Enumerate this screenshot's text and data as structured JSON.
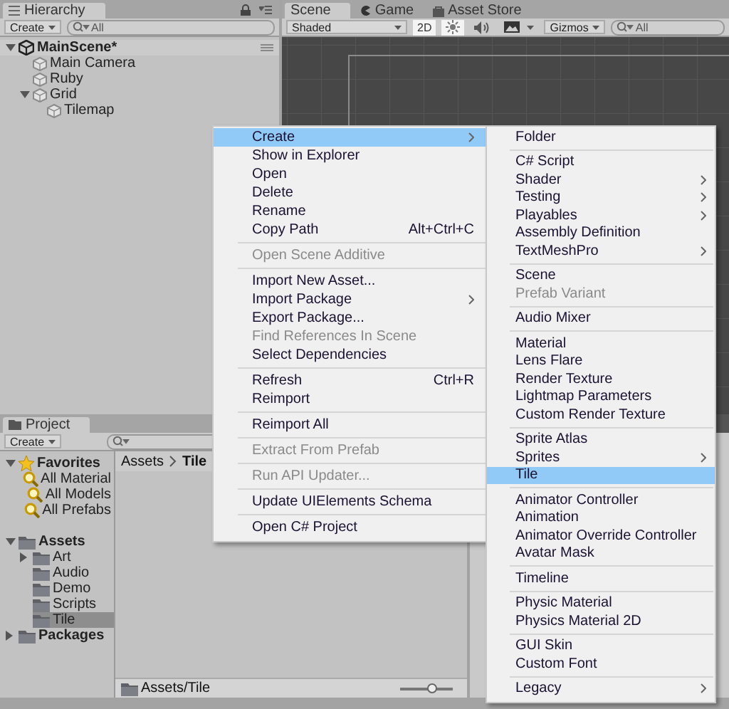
{
  "hierarchy": {
    "tab": "Hierarchy",
    "create_button": "Create",
    "search": {
      "placeholder": "All"
    },
    "scene": {
      "name": "MainScene*",
      "expanded": true,
      "children": [
        {
          "name": "Main Camera",
          "kind": "gameobject"
        },
        {
          "name": "Ruby",
          "kind": "gameobject"
        },
        {
          "name": "Grid",
          "kind": "gameobject",
          "expanded": true,
          "children": [
            {
              "name": "Tilemap",
              "kind": "gameobject"
            }
          ]
        }
      ]
    }
  },
  "scene_view": {
    "tabs": [
      {
        "label": "Scene",
        "kind": "scene",
        "selected": true
      },
      {
        "label": "Game",
        "kind": "game",
        "selected": false
      },
      {
        "label": "Asset Store",
        "kind": "store",
        "selected": false
      }
    ],
    "shading": "Shaded",
    "toggles": [
      {
        "kind": "dimension",
        "label": "2D",
        "on": true
      },
      {
        "kind": "lighting",
        "on": true
      },
      {
        "kind": "audio",
        "on": false
      },
      {
        "kind": "effects",
        "on": false
      }
    ],
    "gizmos": "Gizmos",
    "search": {
      "placeholder": "All"
    }
  },
  "project": {
    "tab": "Project",
    "create_button": "Create",
    "tree": [
      {
        "name": "Favorites",
        "kind": "favorites",
        "expanded": true,
        "selected": false,
        "children": [
          {
            "name": "All Material",
            "kind": "search",
            "selected": false
          },
          {
            "name": "All Models",
            "kind": "search",
            "selected": false
          },
          {
            "name": "All Prefabs",
            "kind": "search",
            "selected": false
          }
        ]
      },
      {
        "name": "Assets",
        "kind": "folder",
        "expanded": true,
        "selected": false,
        "children": [
          {
            "name": "Art",
            "kind": "folder",
            "expanded": false,
            "selected": false
          },
          {
            "name": "Audio",
            "kind": "folder",
            "selected": false
          },
          {
            "name": "Demo",
            "kind": "folder",
            "selected": false
          },
          {
            "name": "Scripts",
            "kind": "folder",
            "selected": false
          },
          {
            "name": "Tile",
            "kind": "folder",
            "selected": true
          }
        ]
      },
      {
        "name": "Packages",
        "kind": "folder",
        "expanded": false,
        "selected": false
      }
    ],
    "breadcrumb": [
      "Assets",
      "Tile"
    ],
    "footer_path": "Assets/Tile",
    "icon_size": {
      "level": 0.6
    }
  },
  "context_menu": {
    "groups": [
      [
        {
          "label": "Create",
          "selected": true,
          "disabled": false,
          "submenu": true
        },
        {
          "label": "Show in Explorer",
          "selected": false,
          "disabled": false,
          "submenu": false
        },
        {
          "label": "Open",
          "selected": false,
          "disabled": false,
          "submenu": false
        },
        {
          "label": "Delete",
          "selected": false,
          "disabled": false,
          "submenu": false
        },
        {
          "label": "Rename",
          "selected": false,
          "disabled": false,
          "submenu": false
        },
        {
          "label": "Copy Path",
          "shortcut": "Alt+Ctrl+C",
          "selected": false,
          "disabled": false,
          "submenu": false
        }
      ],
      [
        {
          "label": "Open Scene Additive",
          "selected": false,
          "disabled": true,
          "submenu": false
        }
      ],
      [
        {
          "label": "Import New Asset...",
          "selected": false,
          "disabled": false,
          "submenu": false
        },
        {
          "label": "Import Package",
          "selected": false,
          "disabled": false,
          "submenu": true
        },
        {
          "label": "Export Package...",
          "selected": false,
          "disabled": false,
          "submenu": false
        },
        {
          "label": "Find References In Scene",
          "selected": false,
          "disabled": true,
          "submenu": false
        },
        {
          "label": "Select Dependencies",
          "selected": false,
          "disabled": false,
          "submenu": false
        }
      ],
      [
        {
          "label": "Refresh",
          "shortcut": "Ctrl+R",
          "selected": false,
          "disabled": false,
          "submenu": false
        },
        {
          "label": "Reimport",
          "selected": false,
          "disabled": false,
          "submenu": false
        }
      ],
      [
        {
          "label": "Reimport All",
          "selected": false,
          "disabled": false,
          "submenu": false
        }
      ],
      [
        {
          "label": "Extract From Prefab",
          "selected": false,
          "disabled": true,
          "submenu": false
        }
      ],
      [
        {
          "label": "Run API Updater...",
          "selected": false,
          "disabled": true,
          "submenu": false
        }
      ],
      [
        {
          "label": "Update UIElements Schema",
          "selected": false,
          "disabled": false,
          "submenu": false
        }
      ],
      [
        {
          "label": "Open C# Project",
          "selected": false,
          "disabled": false,
          "submenu": false
        }
      ]
    ]
  },
  "create_submenu": {
    "groups": [
      [
        {
          "label": "Folder",
          "selected": false,
          "disabled": false,
          "submenu": false
        }
      ],
      [
        {
          "label": "C# Script",
          "selected": false,
          "disabled": false,
          "submenu": false
        },
        {
          "label": "Shader",
          "selected": false,
          "disabled": false,
          "submenu": true
        },
        {
          "label": "Testing",
          "selected": false,
          "disabled": false,
          "submenu": true
        },
        {
          "label": "Playables",
          "selected": false,
          "disabled": false,
          "submenu": true
        },
        {
          "label": "Assembly Definition",
          "selected": false,
          "disabled": false,
          "submenu": false
        },
        {
          "label": "TextMeshPro",
          "selected": false,
          "disabled": false,
          "submenu": true
        }
      ],
      [
        {
          "label": "Scene",
          "selected": false,
          "disabled": false,
          "submenu": false
        },
        {
          "label": "Prefab Variant",
          "selected": false,
          "disabled": true,
          "submenu": false
        }
      ],
      [
        {
          "label": "Audio Mixer",
          "selected": false,
          "disabled": false,
          "submenu": false
        }
      ],
      [
        {
          "label": "Material",
          "selected": false,
          "disabled": false,
          "submenu": false
        },
        {
          "label": "Lens Flare",
          "selected": false,
          "disabled": false,
          "submenu": false
        },
        {
          "label": "Render Texture",
          "selected": false,
          "disabled": false,
          "submenu": false
        },
        {
          "label": "Lightmap Parameters",
          "selected": false,
          "disabled": false,
          "submenu": false
        },
        {
          "label": "Custom Render Texture",
          "selected": false,
          "disabled": false,
          "submenu": false
        }
      ],
      [
        {
          "label": "Sprite Atlas",
          "selected": false,
          "disabled": false,
          "submenu": false
        },
        {
          "label": "Sprites",
          "selected": false,
          "disabled": false,
          "submenu": true
        },
        {
          "label": "Tile",
          "selected": true,
          "disabled": false,
          "submenu": false
        }
      ],
      [
        {
          "label": "Animator Controller",
          "selected": false,
          "disabled": false,
          "submenu": false
        },
        {
          "label": "Animation",
          "selected": false,
          "disabled": false,
          "submenu": false
        },
        {
          "label": "Animator Override Controller",
          "selected": false,
          "disabled": false,
          "submenu": false
        },
        {
          "label": "Avatar Mask",
          "selected": false,
          "disabled": false,
          "submenu": false
        }
      ],
      [
        {
          "label": "Timeline",
          "selected": false,
          "disabled": false,
          "submenu": false
        }
      ],
      [
        {
          "label": "Physic Material",
          "selected": false,
          "disabled": false,
          "submenu": false
        },
        {
          "label": "Physics Material 2D",
          "selected": false,
          "disabled": false,
          "submenu": false
        }
      ],
      [
        {
          "label": "GUI Skin",
          "selected": false,
          "disabled": false,
          "submenu": false
        },
        {
          "label": "Custom Font",
          "selected": false,
          "disabled": false,
          "submenu": false
        }
      ],
      [
        {
          "label": "Legacy",
          "selected": false,
          "disabled": false,
          "submenu": true
        }
      ]
    ]
  }
}
